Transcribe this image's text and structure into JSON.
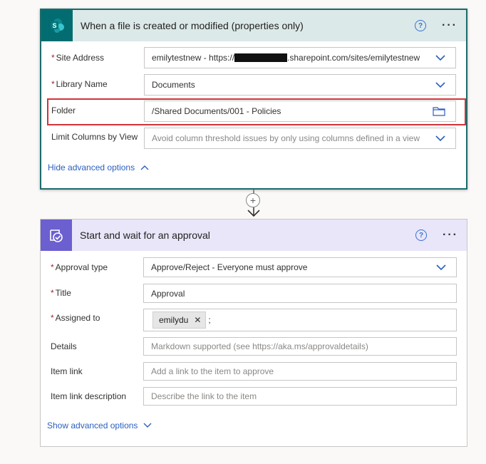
{
  "trigger": {
    "title": "When a file is created or modified (properties only)",
    "help_icon": "question-circle-icon",
    "more_label": "···",
    "site_address": {
      "label": "Site Address",
      "value_prefix": "emilytestnew - https://",
      "value_suffix": ".sharepoint.com/sites/emilytestnew"
    },
    "library_name": {
      "label": "Library Name",
      "value": "Documents"
    },
    "folder": {
      "label": "Folder",
      "value": "/Shared Documents/001 - Policies"
    },
    "limit_columns": {
      "label": "Limit Columns by View",
      "placeholder": "Avoid column threshold issues by only using columns defined in a view"
    },
    "advanced_link": "Hide advanced options"
  },
  "connector": {
    "plus_label": "+"
  },
  "approval": {
    "title": "Start and wait for an approval",
    "more_label": "···",
    "approval_type": {
      "label": "Approval type",
      "value": "Approve/Reject - Everyone must approve"
    },
    "title_field": {
      "label": "Title",
      "value": "Approval"
    },
    "assigned_to": {
      "label": "Assigned to",
      "token": "emilydu",
      "separator": ";"
    },
    "details": {
      "label": "Details",
      "placeholder": "Markdown supported (see https://aka.ms/approvaldetails)"
    },
    "item_link": {
      "label": "Item link",
      "placeholder": "Add a link to the item to approve"
    },
    "item_link_description": {
      "label": "Item link description",
      "placeholder": "Describe the link to the item"
    },
    "advanced_link": "Show advanced options"
  },
  "colors": {
    "trigger_accent": "#036c70",
    "approval_accent": "#6c5fd0",
    "highlight": "#d13438",
    "link": "#2b5fbf",
    "required": "#a4262c"
  }
}
